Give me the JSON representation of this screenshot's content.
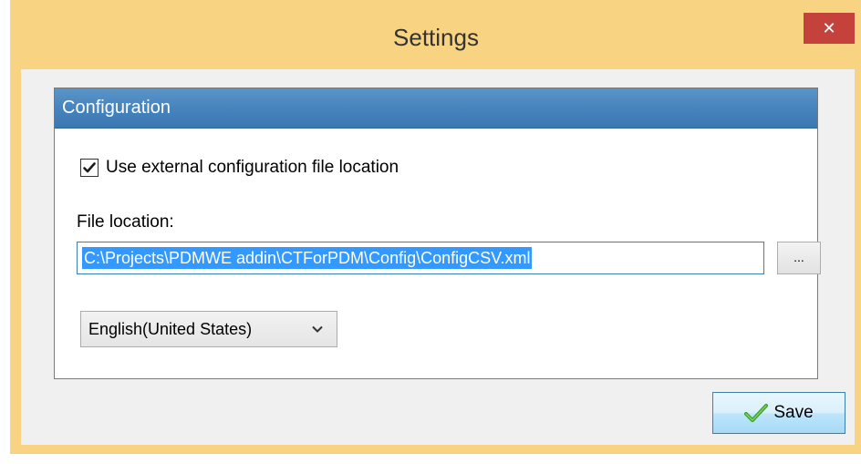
{
  "window": {
    "title": "Settings",
    "close_glyph": "✕"
  },
  "panel": {
    "header": "Configuration",
    "use_external": {
      "label": "Use external configuration file location",
      "checked": true
    },
    "file_location": {
      "label": "File location:",
      "value": "C:\\Projects\\PDMWE addin\\CTForPDM\\Config\\ConfigCSV.xml",
      "browse_label": "..."
    },
    "language": {
      "selected": "English(United States)"
    }
  },
  "footer": {
    "save_label": "Save"
  },
  "colors": {
    "accent_header": "#4784bd",
    "window_frame": "#f7d382",
    "close_red": "#c4413c",
    "selection_blue": "#3399ff"
  },
  "icons": {
    "close": "close-icon",
    "checkmark": "checkmark-icon",
    "chevron": "chevron-down-icon",
    "save": "green-check-icon"
  }
}
